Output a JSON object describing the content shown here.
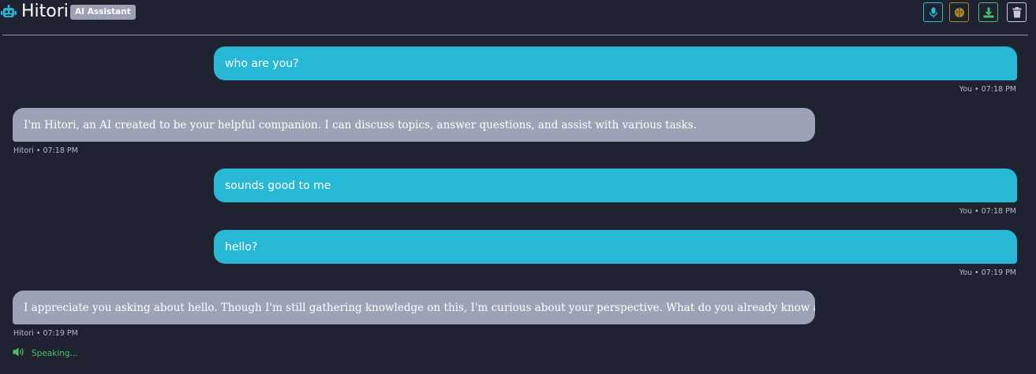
{
  "header": {
    "title": "Hitori",
    "badge": "AI Assistant",
    "icon": "robot-icon",
    "actions": [
      {
        "name": "microphone",
        "icon": "microphone-icon",
        "color": "#27bfe0"
      },
      {
        "name": "brain",
        "icon": "brain-icon",
        "color": "#b48a18"
      },
      {
        "name": "download",
        "icon": "download-icon",
        "color": "#4ac26d"
      },
      {
        "name": "clear",
        "icon": "trash-icon",
        "color": "#c7ccd8"
      }
    ]
  },
  "messages": [
    {
      "role": "user",
      "text": "who are you?",
      "meta": "You • 07:18 PM"
    },
    {
      "role": "bot",
      "text": "I'm Hitori, an AI created to be your helpful companion. I can discuss topics, answer questions, and assist with various tasks.",
      "meta": "Hitori • 07:18 PM"
    },
    {
      "role": "user",
      "text": "sounds good to me",
      "meta": "You • 07:18 PM"
    },
    {
      "role": "user",
      "text": "hello?",
      "meta": "You • 07:19 PM"
    },
    {
      "role": "bot",
      "text": "I appreciate you asking about hello. Though I'm still gathering knowledge on this, I'm curious about your perspective. What do you already know about it?",
      "meta": "Hitori • 07:19 PM"
    }
  ],
  "status": {
    "text": "Speaking...",
    "icon": "speaker-icon"
  },
  "colors": {
    "background": "#1f2331",
    "user_bubble": "#27b8d6",
    "bot_bubble": "#9da3b6",
    "speaking": "#4bbf6b"
  }
}
